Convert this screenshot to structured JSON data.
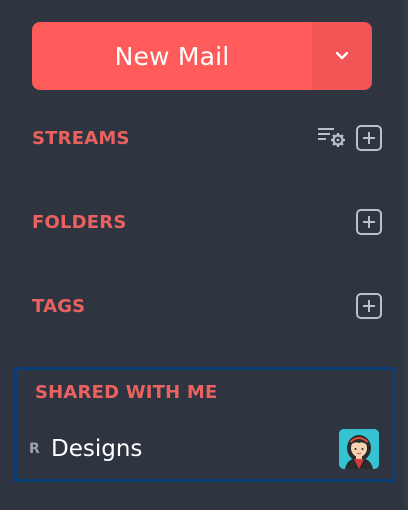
{
  "compose": {
    "label": "New Mail",
    "dropdown_icon": "chevron-down-icon",
    "color": "#ff5b5b"
  },
  "sections": {
    "streams": {
      "label": "STREAMS",
      "icons": [
        "filter-settings-icon",
        "plus-icon"
      ]
    },
    "folders": {
      "label": "FOLDERS",
      "icons": [
        "plus-icon"
      ]
    },
    "tags": {
      "label": "TAGS",
      "icons": [
        "plus-icon"
      ]
    }
  },
  "shared": {
    "label": "SHARED WITH ME",
    "items": [
      {
        "prefix": "R",
        "name": "Designs",
        "avatar_icon": "user-avatar"
      }
    ]
  },
  "colors": {
    "background": "#2e3540",
    "section_label": "#e9625f",
    "focus_border": "#0a3f78"
  }
}
